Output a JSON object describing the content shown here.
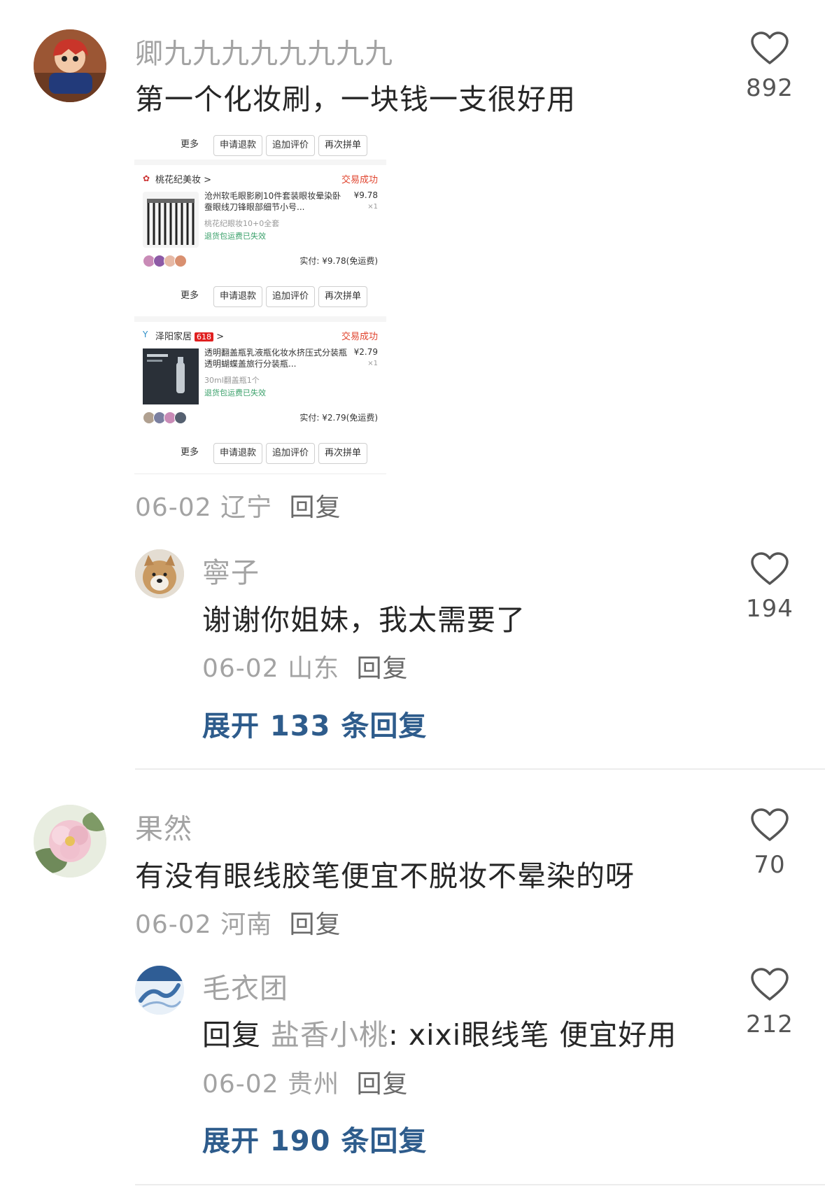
{
  "comments": [
    {
      "username": "卿九九九九九九九九",
      "text": "第一个化妆刷，一块钱一支很好用",
      "date": "06-02",
      "location": "辽宁",
      "reply_label": "回复",
      "likes": "892"
    },
    {
      "username": "寧子",
      "text": "谢谢你姐妹，我太需要了",
      "date": "06-02",
      "location": "山东",
      "reply_label": "回复",
      "likes": "194",
      "expand": "展开 133 条回复"
    },
    {
      "username": "果然",
      "text": "有没有眼线胶笔便宜不脱妆不晕染的呀",
      "date": "06-02",
      "location": "河南",
      "reply_label": "回复",
      "likes": "70"
    },
    {
      "username": "毛衣团",
      "reply_prefix": "回复",
      "mention": "盐香小桃",
      "text": ": xixi眼线笔  便宜好用",
      "date": "06-02",
      "location": "贵州",
      "reply_label": "回复",
      "likes": "212",
      "expand": "展开 190 条回复"
    }
  ],
  "order_screenshot": {
    "buttons": {
      "more": "更多",
      "refund": "申请退款",
      "review": "追加评价",
      "rebuy": "再次拼单"
    },
    "orders": [
      {
        "shop": "桃花纪美妆 >",
        "status": "交易成功",
        "title": "沧州软毛眼影刷10件套装眼妆晕染卧蚕眼线刀锋眼部细节小号...",
        "price": "¥9.78",
        "qty": "×1",
        "spec": "桃花纪眼妆10+0全套",
        "note": "退货包运费已失效",
        "paid": "实付: ¥9.78(免运费)"
      },
      {
        "shop": "泽阳家居",
        "badge": "618",
        "status": "交易成功",
        "title": "透明翻盖瓶乳液瓶化妆水挤压式分装瓶透明蝴蝶盖旅行分装瓶...",
        "price": "¥2.79",
        "qty": "×1",
        "spec": "30ml翻盖瓶1个",
        "note": "退货包运费已失效",
        "paid": "实付: ¥2.79(免运费)"
      }
    ]
  },
  "colors": {
    "link": "#2e5c8c",
    "muted": "#a3a3a3",
    "success": "#e0442e"
  }
}
